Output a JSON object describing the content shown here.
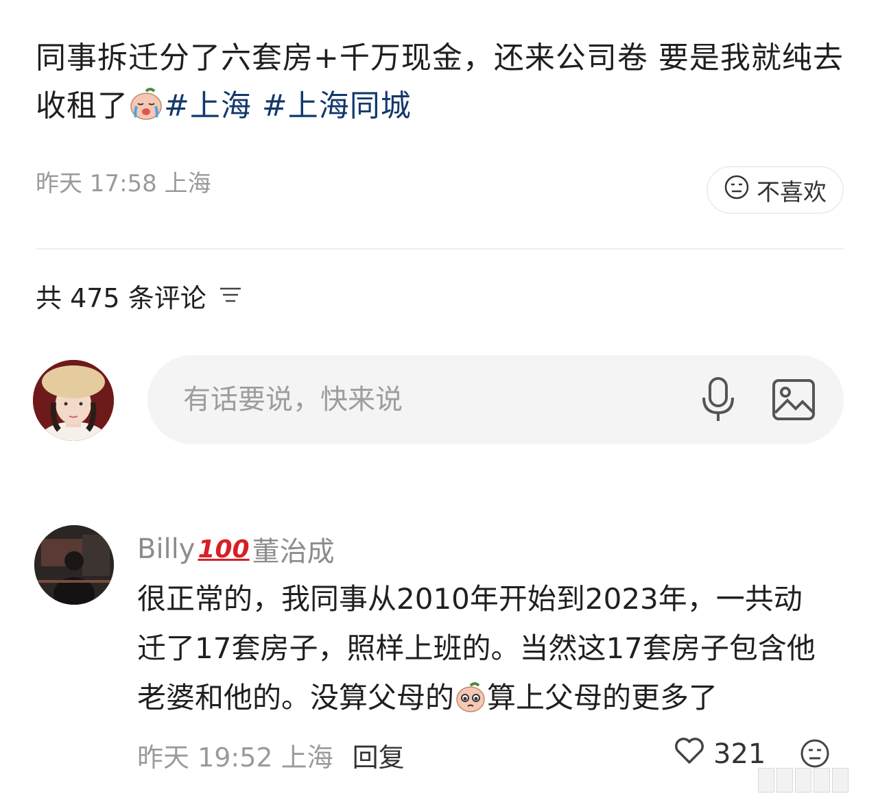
{
  "post": {
    "text_part1": "同事拆迁分了六套房+千万现金，还来公司卷 要是我就纯去收租了",
    "tag1": "#上海",
    "tag2": "#上海同城",
    "time": "昨天 17:58 上海",
    "dislike_label": "不喜欢"
  },
  "comments_header": {
    "label": "共 475 条评论"
  },
  "composer": {
    "placeholder": "有话要说，快来说"
  },
  "comment": {
    "username_part1": "Billy",
    "badge": "100",
    "username_part2": "董治成",
    "text_part1": "很正常的，我同事从2010年开始到2023年，一共动迁了17套房子，照样上班的。当然这17套房子包含他老婆和他的。没算父母的",
    "text_part2": "算上父母的更多了",
    "time": "昨天 19:52 上海",
    "reply_label": "回复",
    "like_count": "321"
  },
  "icons": {
    "dislike": "neutral-face-icon",
    "sort": "sort-lines-icon",
    "mic": "microphone-icon",
    "image": "image-icon",
    "like": "heart-icon"
  },
  "colors": {
    "hashtag": "#13386c",
    "muted": "#9a9a9a",
    "badge": "#d81f26"
  }
}
